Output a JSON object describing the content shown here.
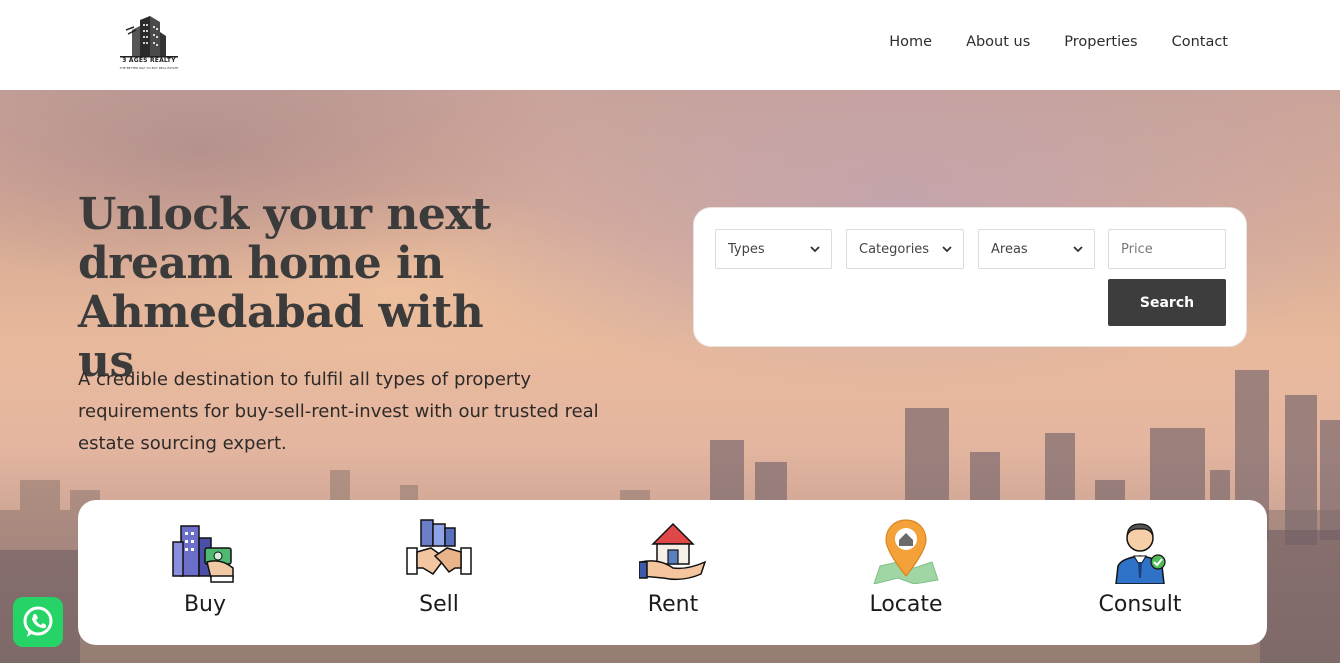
{
  "brand": {
    "name": "3 AGES REALTY",
    "tagline": "THE BETTER WAY TO BUY REAL ESTATE"
  },
  "nav": {
    "items": [
      {
        "label": "Home"
      },
      {
        "label": "About us"
      },
      {
        "label": "Properties"
      },
      {
        "label": "Contact"
      }
    ]
  },
  "hero": {
    "headline": "Unlock your next dream home in Ahmedabad with us",
    "subtext": "A credible destination to fulfil all types of property requirements for buy-sell-rent-invest with our trusted real estate sourcing expert."
  },
  "search": {
    "types": "Types",
    "categories": "Categories",
    "areas": "Areas",
    "price_placeholder": "Price",
    "button": "Search"
  },
  "services": [
    {
      "label": "Buy",
      "icon": "buy-building-cash-icon"
    },
    {
      "label": "Sell",
      "icon": "sell-handshake-icon"
    },
    {
      "label": "Rent",
      "icon": "rent-house-hand-icon"
    },
    {
      "label": "Locate",
      "icon": "locate-map-pin-icon"
    },
    {
      "label": "Consult",
      "icon": "consult-agent-icon"
    }
  ],
  "colors": {
    "button_dark": "#3d3d3d",
    "whatsapp": "#25d366",
    "headline": "#3c3b3b"
  }
}
